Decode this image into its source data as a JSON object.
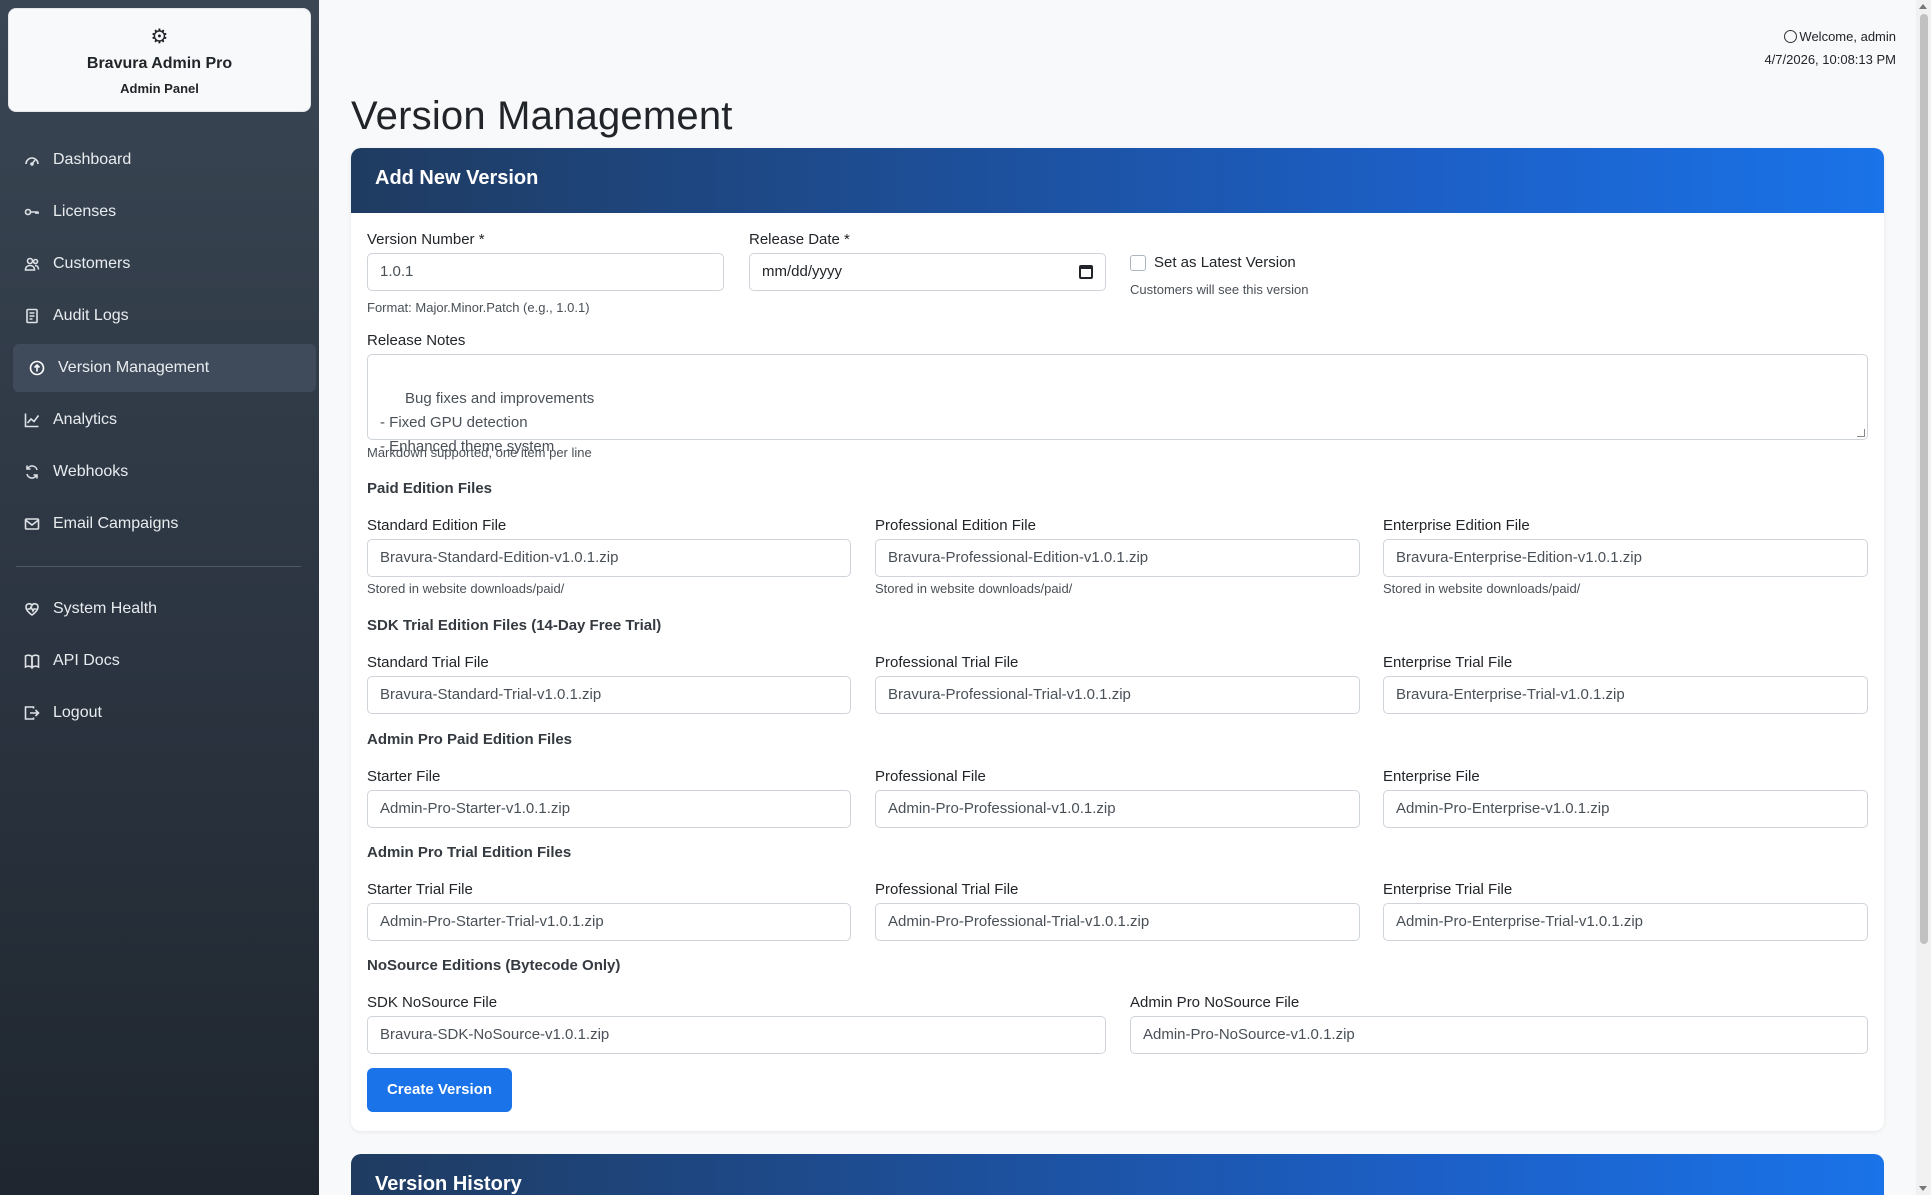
{
  "brand": {
    "title": "Bravura Admin Pro",
    "subtitle": "Admin Panel",
    "icon": "gear-icon"
  },
  "sidebar": {
    "items": [
      {
        "label": "Dashboard",
        "icon": "dashboard-icon"
      },
      {
        "label": "Licenses",
        "icon": "key-icon"
      },
      {
        "label": "Customers",
        "icon": "people-icon"
      },
      {
        "label": "Audit Logs",
        "icon": "journal-icon"
      },
      {
        "label": "Version Management",
        "icon": "upload-circle-icon",
        "active": true
      },
      {
        "label": "Analytics",
        "icon": "chart-line-icon"
      },
      {
        "label": "Webhooks",
        "icon": "refresh-icon"
      },
      {
        "label": "Email Campaigns",
        "icon": "envelope-icon"
      }
    ],
    "bottom_items": [
      {
        "label": "System Health",
        "icon": "heart-pulse-icon"
      },
      {
        "label": "API Docs",
        "icon": "book-icon"
      },
      {
        "label": "Logout",
        "icon": "logout-icon"
      }
    ]
  },
  "header": {
    "welcome": "Welcome, admin",
    "datetime": "4/7/2026, 10:08:13 PM"
  },
  "page": {
    "title": "Version Management"
  },
  "form": {
    "card_title": "Add New Version",
    "version": {
      "label": "Version Number *",
      "value": "1.0.1",
      "help": "Format: Major.Minor.Patch (e.g., 1.0.1)"
    },
    "release_date": {
      "label": "Release Date *",
      "value": "mm/dd/yyyy"
    },
    "latest": {
      "label": "Set as Latest Version",
      "help": "Customers will see this version",
      "checked": false
    },
    "notes": {
      "label": "Release Notes",
      "value": "Bug fixes and improvements\n- Fixed GPU detection\n- Enhanced theme system",
      "help": "Markdown supported, one item per line"
    },
    "paid": {
      "section": "Paid Edition Files",
      "standard": {
        "label": "Standard Edition File",
        "value": "Bravura-Standard-Edition-v1.0.1.zip",
        "help": "Stored in website downloads/paid/"
      },
      "professional": {
        "label": "Professional Edition File",
        "value": "Bravura-Professional-Edition-v1.0.1.zip",
        "help": "Stored in website downloads/paid/"
      },
      "enterprise": {
        "label": "Enterprise Edition File",
        "value": "Bravura-Enterprise-Edition-v1.0.1.zip",
        "help": "Stored in website downloads/paid/"
      }
    },
    "trial": {
      "section": "SDK Trial Edition Files (14-Day Free Trial)",
      "standard": {
        "label": "Standard Trial File",
        "value": "Bravura-Standard-Trial-v1.0.1.zip"
      },
      "professional": {
        "label": "Professional Trial File",
        "value": "Bravura-Professional-Trial-v1.0.1.zip"
      },
      "enterprise": {
        "label": "Enterprise Trial File",
        "value": "Bravura-Enterprise-Trial-v1.0.1.zip"
      }
    },
    "ap_paid": {
      "section": "Admin Pro Paid Edition Files",
      "starter": {
        "label": "Starter File",
        "value": "Admin-Pro-Starter-v1.0.1.zip"
      },
      "professional": {
        "label": "Professional File",
        "value": "Admin-Pro-Professional-v1.0.1.zip"
      },
      "enterprise": {
        "label": "Enterprise File",
        "value": "Admin-Pro-Enterprise-v1.0.1.zip"
      }
    },
    "ap_trial": {
      "section": "Admin Pro Trial Edition Files",
      "starter": {
        "label": "Starter Trial File",
        "value": "Admin-Pro-Starter-Trial-v1.0.1.zip"
      },
      "professional": {
        "label": "Professional Trial File",
        "value": "Admin-Pro-Professional-Trial-v1.0.1.zip"
      },
      "enterprise": {
        "label": "Enterprise Trial File",
        "value": "Admin-Pro-Enterprise-Trial-v1.0.1.zip"
      }
    },
    "nosource": {
      "section": "NoSource Editions (Bytecode Only)",
      "sdk": {
        "label": "SDK NoSource File",
        "value": "Bravura-SDK-NoSource-v1.0.1.zip"
      },
      "adminpro": {
        "label": "Admin Pro NoSource File",
        "value": "Admin-Pro-NoSource-v1.0.1.zip"
      }
    },
    "submit": "Create Version"
  },
  "history": {
    "title": "Version History"
  },
  "colors": {
    "accent": "#1a73e8",
    "sidebar": "#2b3440",
    "header_dark": "#1f3b60"
  }
}
